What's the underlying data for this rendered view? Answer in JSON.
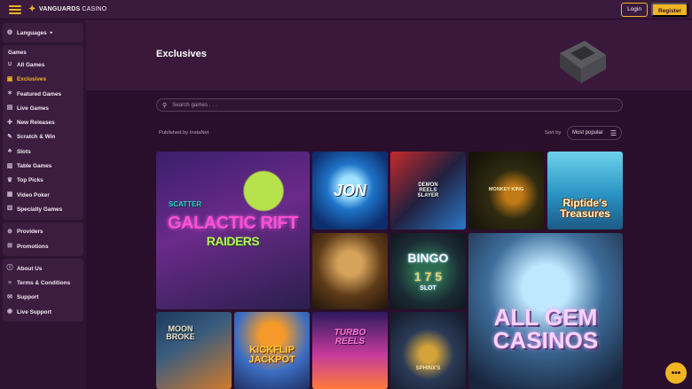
{
  "header": {
    "brand_bold": "VANGUARDS",
    "brand_light": "CASINO",
    "login_label": "Login",
    "register_label": "Register"
  },
  "sidebar": {
    "languages_label": "Languages",
    "games_heading": "Games",
    "games": [
      {
        "label": "All Games",
        "icon": "horseshoe-icon"
      },
      {
        "label": "Exclusives",
        "icon": "exclusive-icon"
      },
      {
        "label": "Featured Games",
        "icon": "star-icon"
      },
      {
        "label": "Live Games",
        "icon": "live-icon"
      },
      {
        "label": "New Releases",
        "icon": "new-icon"
      },
      {
        "label": "Scratch & Win",
        "icon": "scratch-icon"
      },
      {
        "label": "Slots",
        "icon": "cherry-icon"
      },
      {
        "label": "Table Games",
        "icon": "cards-icon"
      },
      {
        "label": "Top Picks",
        "icon": "trophy-icon"
      },
      {
        "label": "Video Poker",
        "icon": "poker-icon"
      },
      {
        "label": "Specialty Games",
        "icon": "dice-icon"
      }
    ],
    "providers_label": "Providers",
    "promotions_label": "Promotions",
    "about_us_label": "About Us",
    "terms_label": "Terms & Conditions",
    "support_label": "Support",
    "live_support_label": "Live Support"
  },
  "banner": {
    "title": "Exclusives"
  },
  "filters": {
    "search_placeholder": "Search games . . .",
    "publisher_text": "Published by InstaNet",
    "sort_label": "Sort by",
    "sort_value": "Most popular"
  },
  "tiles": {
    "galactic_title": "GALACTIC RIFT",
    "galactic_subtitle": "RAIDERS",
    "galactic_scatter": "SCATTER",
    "jon_title": "JON",
    "demon_title": "DEMON REELS SLAYER",
    "monkey_title": "MONKEY KING",
    "riptide_title": "Riptide's Treasures",
    "bingo_title": "BINGO",
    "bingo_number": "1 7 5",
    "bingo_sub": "SLOT",
    "allgem_title": "ALL GEM CASINOS",
    "moon_title": "MOON BROKE",
    "kickflip_title": "KICKFLIP JACKPOT",
    "turbo_title": "TURBO REELS",
    "sphinx_title": "SPHINX'S"
  },
  "colors": {
    "accent": "#f1b523",
    "background": "#2a0f2c",
    "sidebar": "#2f1432",
    "sidebar_block": "#3c1d40"
  }
}
